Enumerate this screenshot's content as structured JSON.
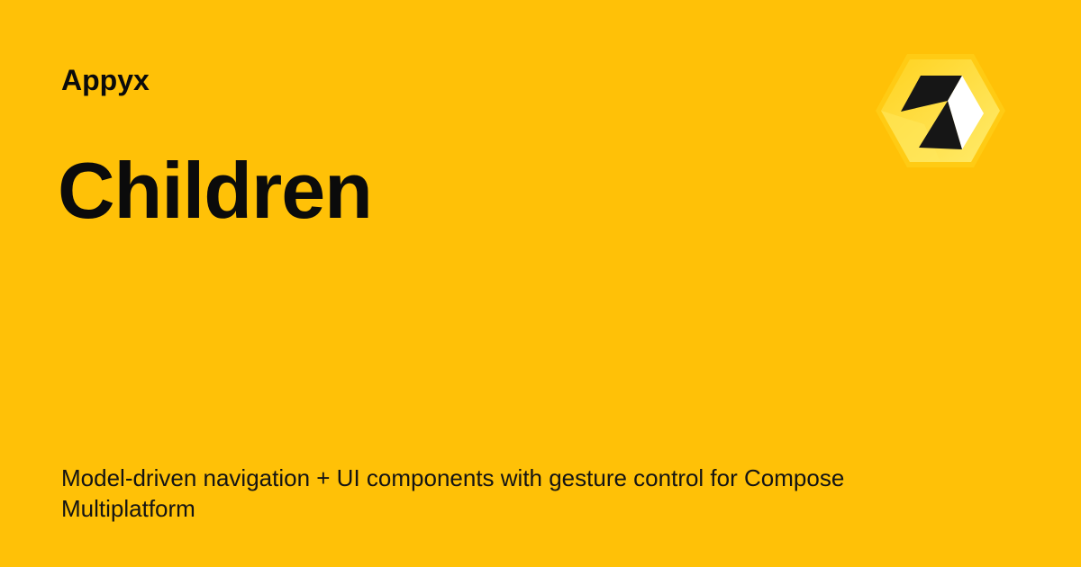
{
  "site": {
    "name": "Appyx"
  },
  "page": {
    "title": "Children",
    "description": "Model-driven navigation + UI components with gesture control for Compose Multiplatform"
  },
  "logo": {
    "icon": "appyx-hexagon-logo-icon"
  },
  "colors": {
    "background": "#FFC107",
    "text": "#0B0B0B",
    "logo_dark": "#1A1A1A",
    "logo_light": "#FFFFFF",
    "logo_hex": "#FFE54A"
  }
}
